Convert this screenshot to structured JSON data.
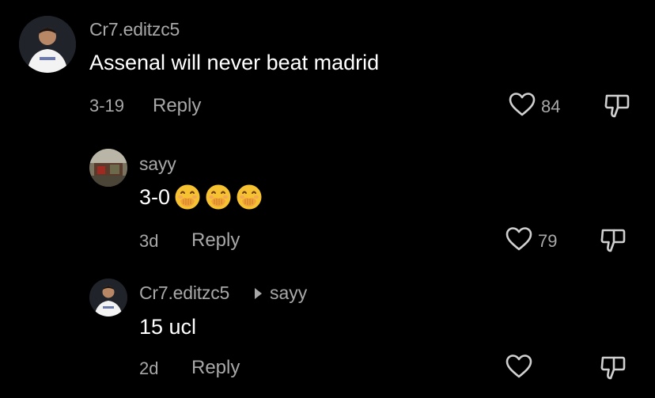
{
  "comments": [
    {
      "username": "Cr7.editzc5",
      "text": "Assenal will never beat madrid",
      "date": "3-19",
      "reply_label": "Reply",
      "likes": "84"
    },
    {
      "username": "sayy",
      "text": "3-0",
      "emojis": [
        "face-with-hand-over-mouth",
        "face-with-hand-over-mouth",
        "face-with-hand-over-mouth"
      ],
      "date": "3d",
      "reply_label": "Reply",
      "likes": "79"
    },
    {
      "username": "Cr7.editzc5",
      "reply_to": "sayy",
      "text": "15 ucl",
      "date": "2d",
      "reply_label": "Reply",
      "likes": ""
    }
  ],
  "colors": {
    "background": "#000000",
    "primary_text": "#ffffff",
    "secondary_text": "#a8a8a8"
  },
  "icons": {
    "like": "heart-outline-icon",
    "dislike": "thumbs-down-outline-icon"
  }
}
